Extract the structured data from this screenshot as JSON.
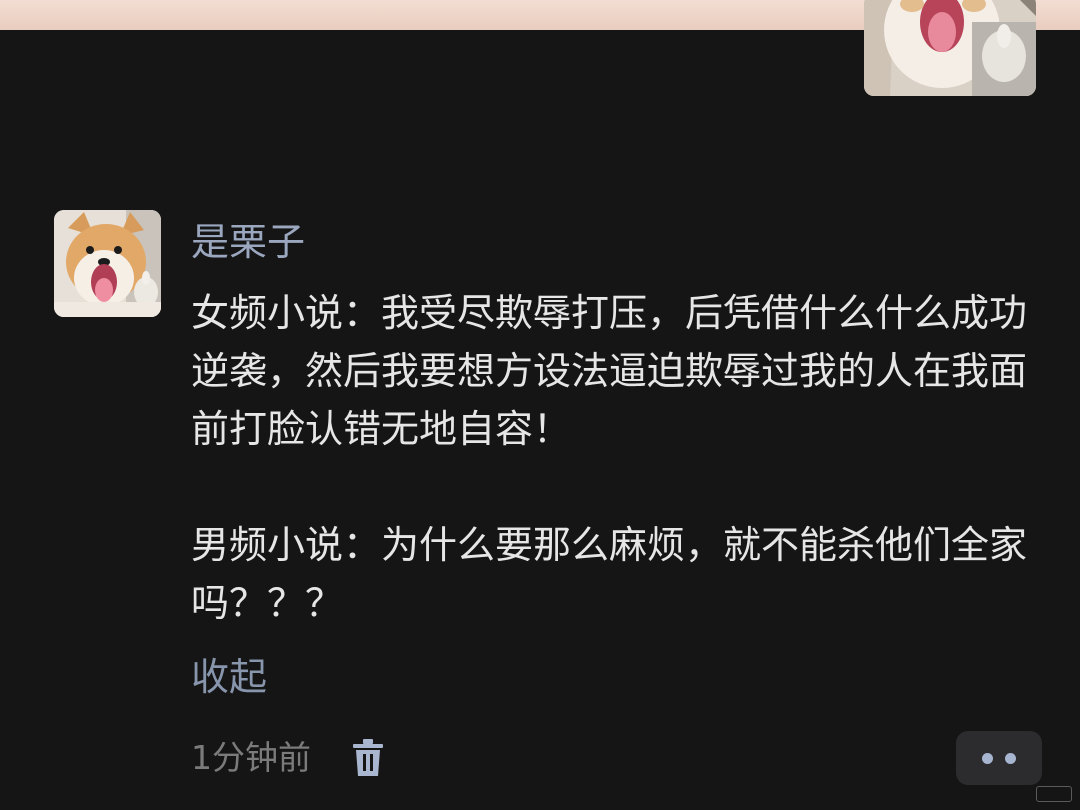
{
  "comment": {
    "username": "是栗子",
    "paragraphs": [
      "女频小说：我受尽欺辱打压，后凭借什么什么成功逆袭，然后我要想方设法逼迫欺辱过我的人在我面前打脸认错无地自容！",
      "男频小说：为什么要那么麻烦，就不能杀他们全家吗？？？"
    ],
    "collapse_label": "收起",
    "timestamp": "1分钟前"
  },
  "icons": {
    "delete": "trash-icon",
    "more": "more-dots-icon"
  },
  "colors": {
    "background": "#151515",
    "username": "#9aa7bf",
    "body_text": "#e6e6e6",
    "link": "#8795ad",
    "meta": "#7b7b7b"
  }
}
